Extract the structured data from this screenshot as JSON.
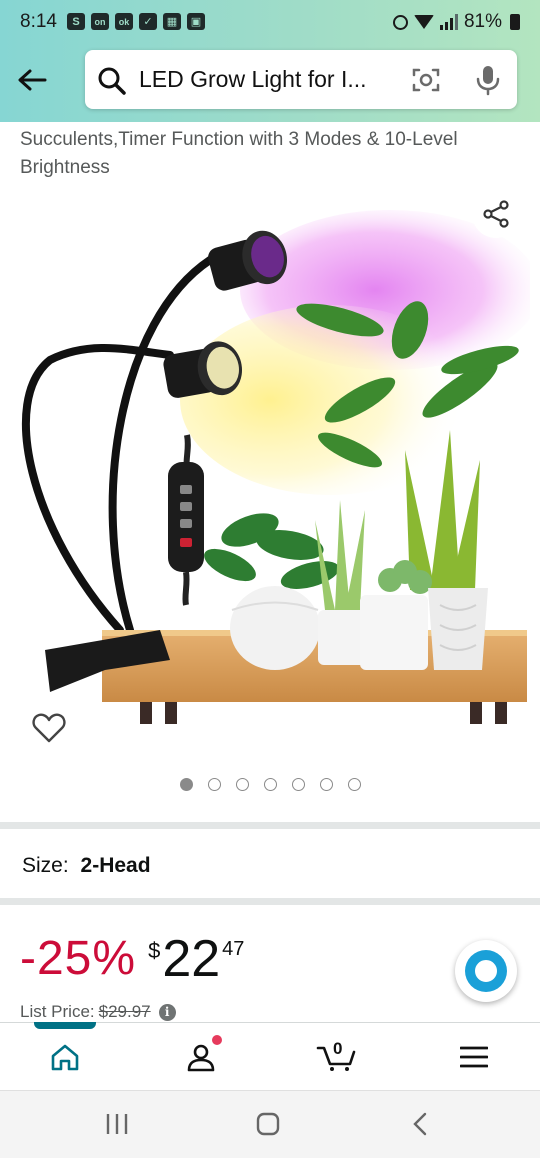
{
  "status_bar": {
    "time": "8:14",
    "battery": "81%",
    "left_icons": [
      "S",
      "on",
      "ok",
      "✓",
      "▦",
      "▣"
    ]
  },
  "search": {
    "query": "LED Grow Light for I..."
  },
  "product": {
    "title_continuation": "Succulents,Timer Function with 3 Modes & 10-Level Brightness",
    "image_count": 7,
    "active_image_index": 0
  },
  "size": {
    "label": "Size:",
    "value": "2-Head"
  },
  "price": {
    "discount": "-25%",
    "currency": "$",
    "whole": "22",
    "fraction": "47",
    "list_label": "List Price:",
    "list_value": "$29.97"
  },
  "nav": {
    "cart_count": "0"
  },
  "colors": {
    "header_start": "#86d6d3",
    "header_end": "#b3e5c0",
    "discount_red": "#cc0c39",
    "teal_accent": "#007185",
    "alexa_blue": "#1aa0d8"
  },
  "icons": [
    "back-arrow-icon",
    "search-icon",
    "camera-icon",
    "mic-icon",
    "share-icon",
    "heart-icon",
    "info-icon",
    "alexa-icon",
    "home-icon",
    "account-icon",
    "cart-icon",
    "menu-icon",
    "recents-icon",
    "home-circle-icon",
    "back-chevron-icon"
  ]
}
